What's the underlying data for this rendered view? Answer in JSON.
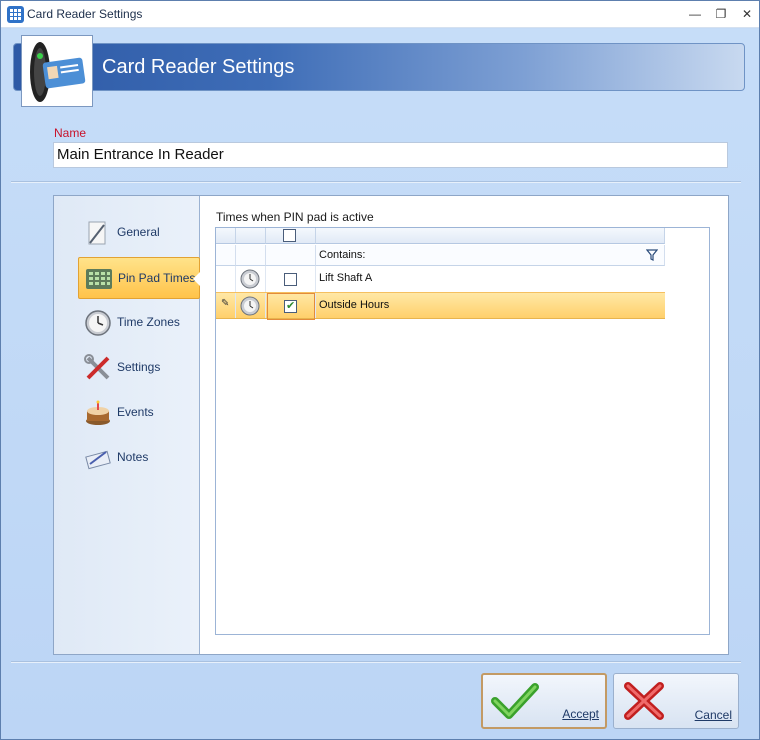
{
  "window": {
    "title": "Card Reader Settings",
    "controls": {
      "minimize": "—",
      "maximize": "❐",
      "close": "✕"
    }
  },
  "banner": {
    "title": "Card Reader Settings",
    "icon": "card-reader-icon"
  },
  "name_field": {
    "label": "Name",
    "value": "Main Entrance In Reader"
  },
  "nav": {
    "items": [
      {
        "label": "General",
        "icon": "pen-icon",
        "active": false
      },
      {
        "label": "Pin Pad Times",
        "icon": "keypad-icon",
        "active": true
      },
      {
        "label": "Time Zones",
        "icon": "clock-icon",
        "active": false
      },
      {
        "label": "Settings",
        "icon": "tools-icon",
        "active": false
      },
      {
        "label": "Events",
        "icon": "cake-icon",
        "active": false
      },
      {
        "label": "Notes",
        "icon": "notepad-icon",
        "active": false
      }
    ]
  },
  "grid": {
    "caption": "Times when PIN pad is active",
    "filter_placeholder": "Contains:",
    "rows": [
      {
        "name": "Lift Shaft A",
        "checked": false,
        "selected": false
      },
      {
        "name": "Outside Hours",
        "checked": true,
        "selected": true
      }
    ]
  },
  "buttons": {
    "accept": "Accept",
    "cancel": "Cancel"
  },
  "colors": {
    "accent": "#2e5aa6",
    "selection": "#ffd06b",
    "name_label": "#c8132b"
  }
}
